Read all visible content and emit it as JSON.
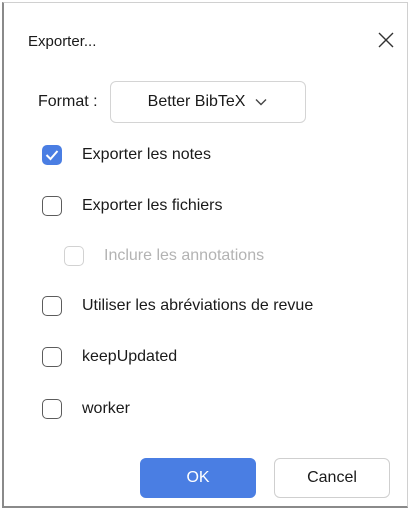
{
  "dialog": {
    "title": "Exporter...",
    "close_icon": "close-icon"
  },
  "format": {
    "label": "Format :",
    "selected": "Better BibTeX",
    "chevron_icon": "chevron-down-icon"
  },
  "options": [
    {
      "label": "Exporter les notes",
      "checked": true,
      "disabled": false
    },
    {
      "label": "Exporter les fichiers",
      "checked": false,
      "disabled": false
    },
    {
      "label": "Inclure les annotations",
      "checked": false,
      "disabled": true
    },
    {
      "label": "Utiliser les abréviations de revue",
      "checked": false,
      "disabled": false
    },
    {
      "label": "keepUpdated",
      "checked": false,
      "disabled": false
    },
    {
      "label": "worker",
      "checked": false,
      "disabled": false
    }
  ],
  "buttons": {
    "ok_label": "OK",
    "cancel_label": "Cancel"
  },
  "colors": {
    "accent": "#4a7ee3",
    "disabled_text": "#b3b3b3"
  }
}
